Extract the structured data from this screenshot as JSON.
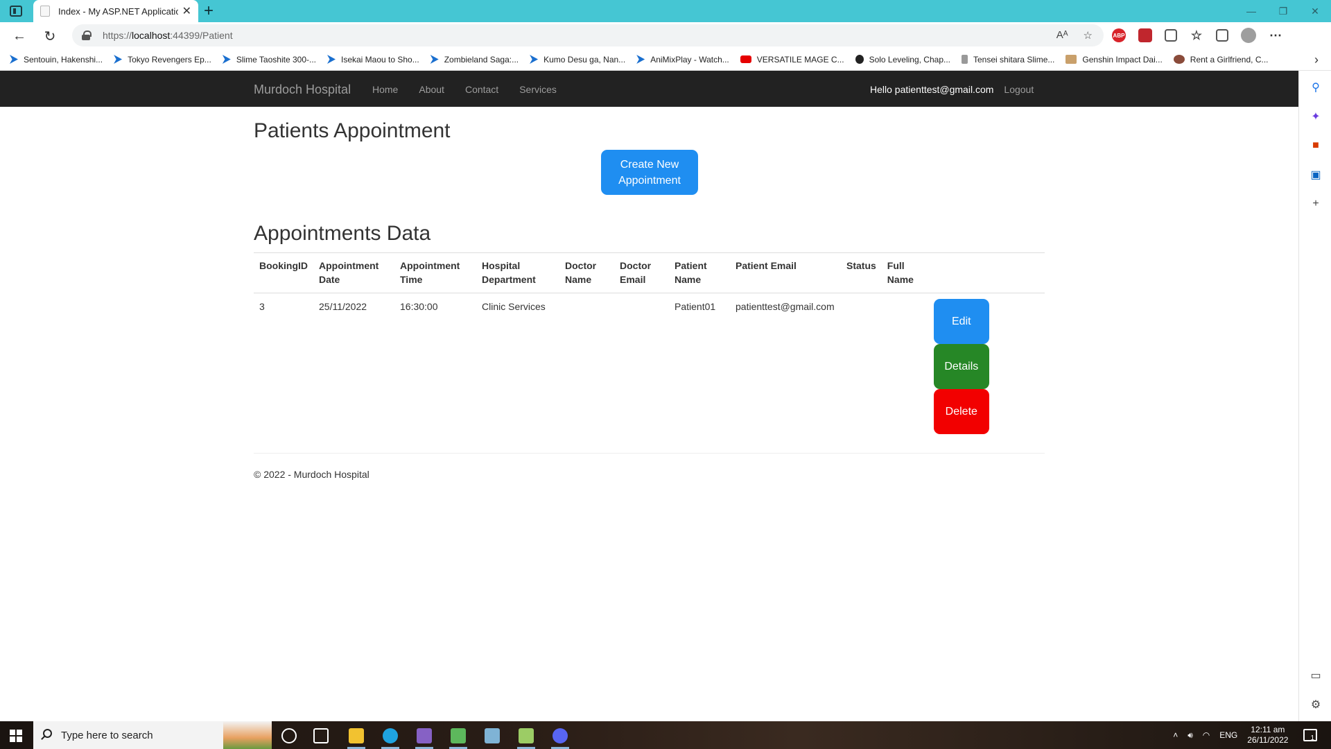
{
  "browser": {
    "tab_title": "Index - My ASP.NET Application",
    "tab_close": "✕",
    "new_tab": "+",
    "url_prefix": "https://",
    "url_host": "localhost",
    "url_rest": ":44399/Patient",
    "bookmarks": [
      {
        "label": "Sentouin, Hakenshi...",
        "icon": "play-icon"
      },
      {
        "label": "Tokyo Revengers Ep...",
        "icon": "play-icon"
      },
      {
        "label": "Slime Taoshite 300-...",
        "icon": "play-icon"
      },
      {
        "label": "Isekai Maou to Sho...",
        "icon": "play-icon"
      },
      {
        "label": "Zombieland Saga:...",
        "icon": "play-icon"
      },
      {
        "label": "Kumo Desu ga, Nan...",
        "icon": "play-icon"
      },
      {
        "label": "AniMixPlay - Watch...",
        "icon": "play-icon"
      },
      {
        "label": "VERSATILE MAGE C...",
        "icon": "youtube-icon"
      },
      {
        "label": "Solo Leveling, Chap...",
        "icon": "shield-icon"
      },
      {
        "label": "Tensei shitara Slime...",
        "icon": "page-icon"
      },
      {
        "label": "Genshin Impact Dai...",
        "icon": "image-icon"
      },
      {
        "label": "Rent a Girlfriend, C...",
        "icon": "image-icon"
      }
    ],
    "extension_badge": "ABP"
  },
  "site": {
    "brand": "Murdoch Hospital",
    "nav": [
      "Home",
      "About",
      "Contact",
      "Services"
    ],
    "greeting": "Hello patienttest@gmail.com",
    "logout": "Logout"
  },
  "main": {
    "title": "Patients Appointment",
    "create_button": "Create New Appointment",
    "section_title": "Appointments Data",
    "columns": [
      "BookingID",
      "Appointment Date",
      "Appointment Time",
      "Hospital Department",
      "Doctor Name",
      "Doctor Email",
      "Patient Name",
      "Patient Email",
      "Status",
      "Full Name"
    ],
    "rows": [
      {
        "cells": [
          "3",
          "25/11/2022",
          "16:30:00",
          "Clinic Services",
          "",
          "",
          "Patient01",
          "patienttest@gmail.com",
          "",
          ""
        ],
        "actions": {
          "edit": "Edit",
          "details": "Details",
          "delete": "Delete"
        }
      }
    ]
  },
  "footer": {
    "text": "© 2022 - Murdoch Hospital"
  },
  "taskbar": {
    "search_placeholder": "Type here to search",
    "language": "ENG",
    "time": "12:11 am",
    "date": "26/11/2022",
    "notification_count": "1"
  },
  "colors": {
    "titlebar": "#45c6d3",
    "navbar": "#222222",
    "edit": "#1f8ef1",
    "details": "#268726",
    "delete": "#f20000"
  }
}
